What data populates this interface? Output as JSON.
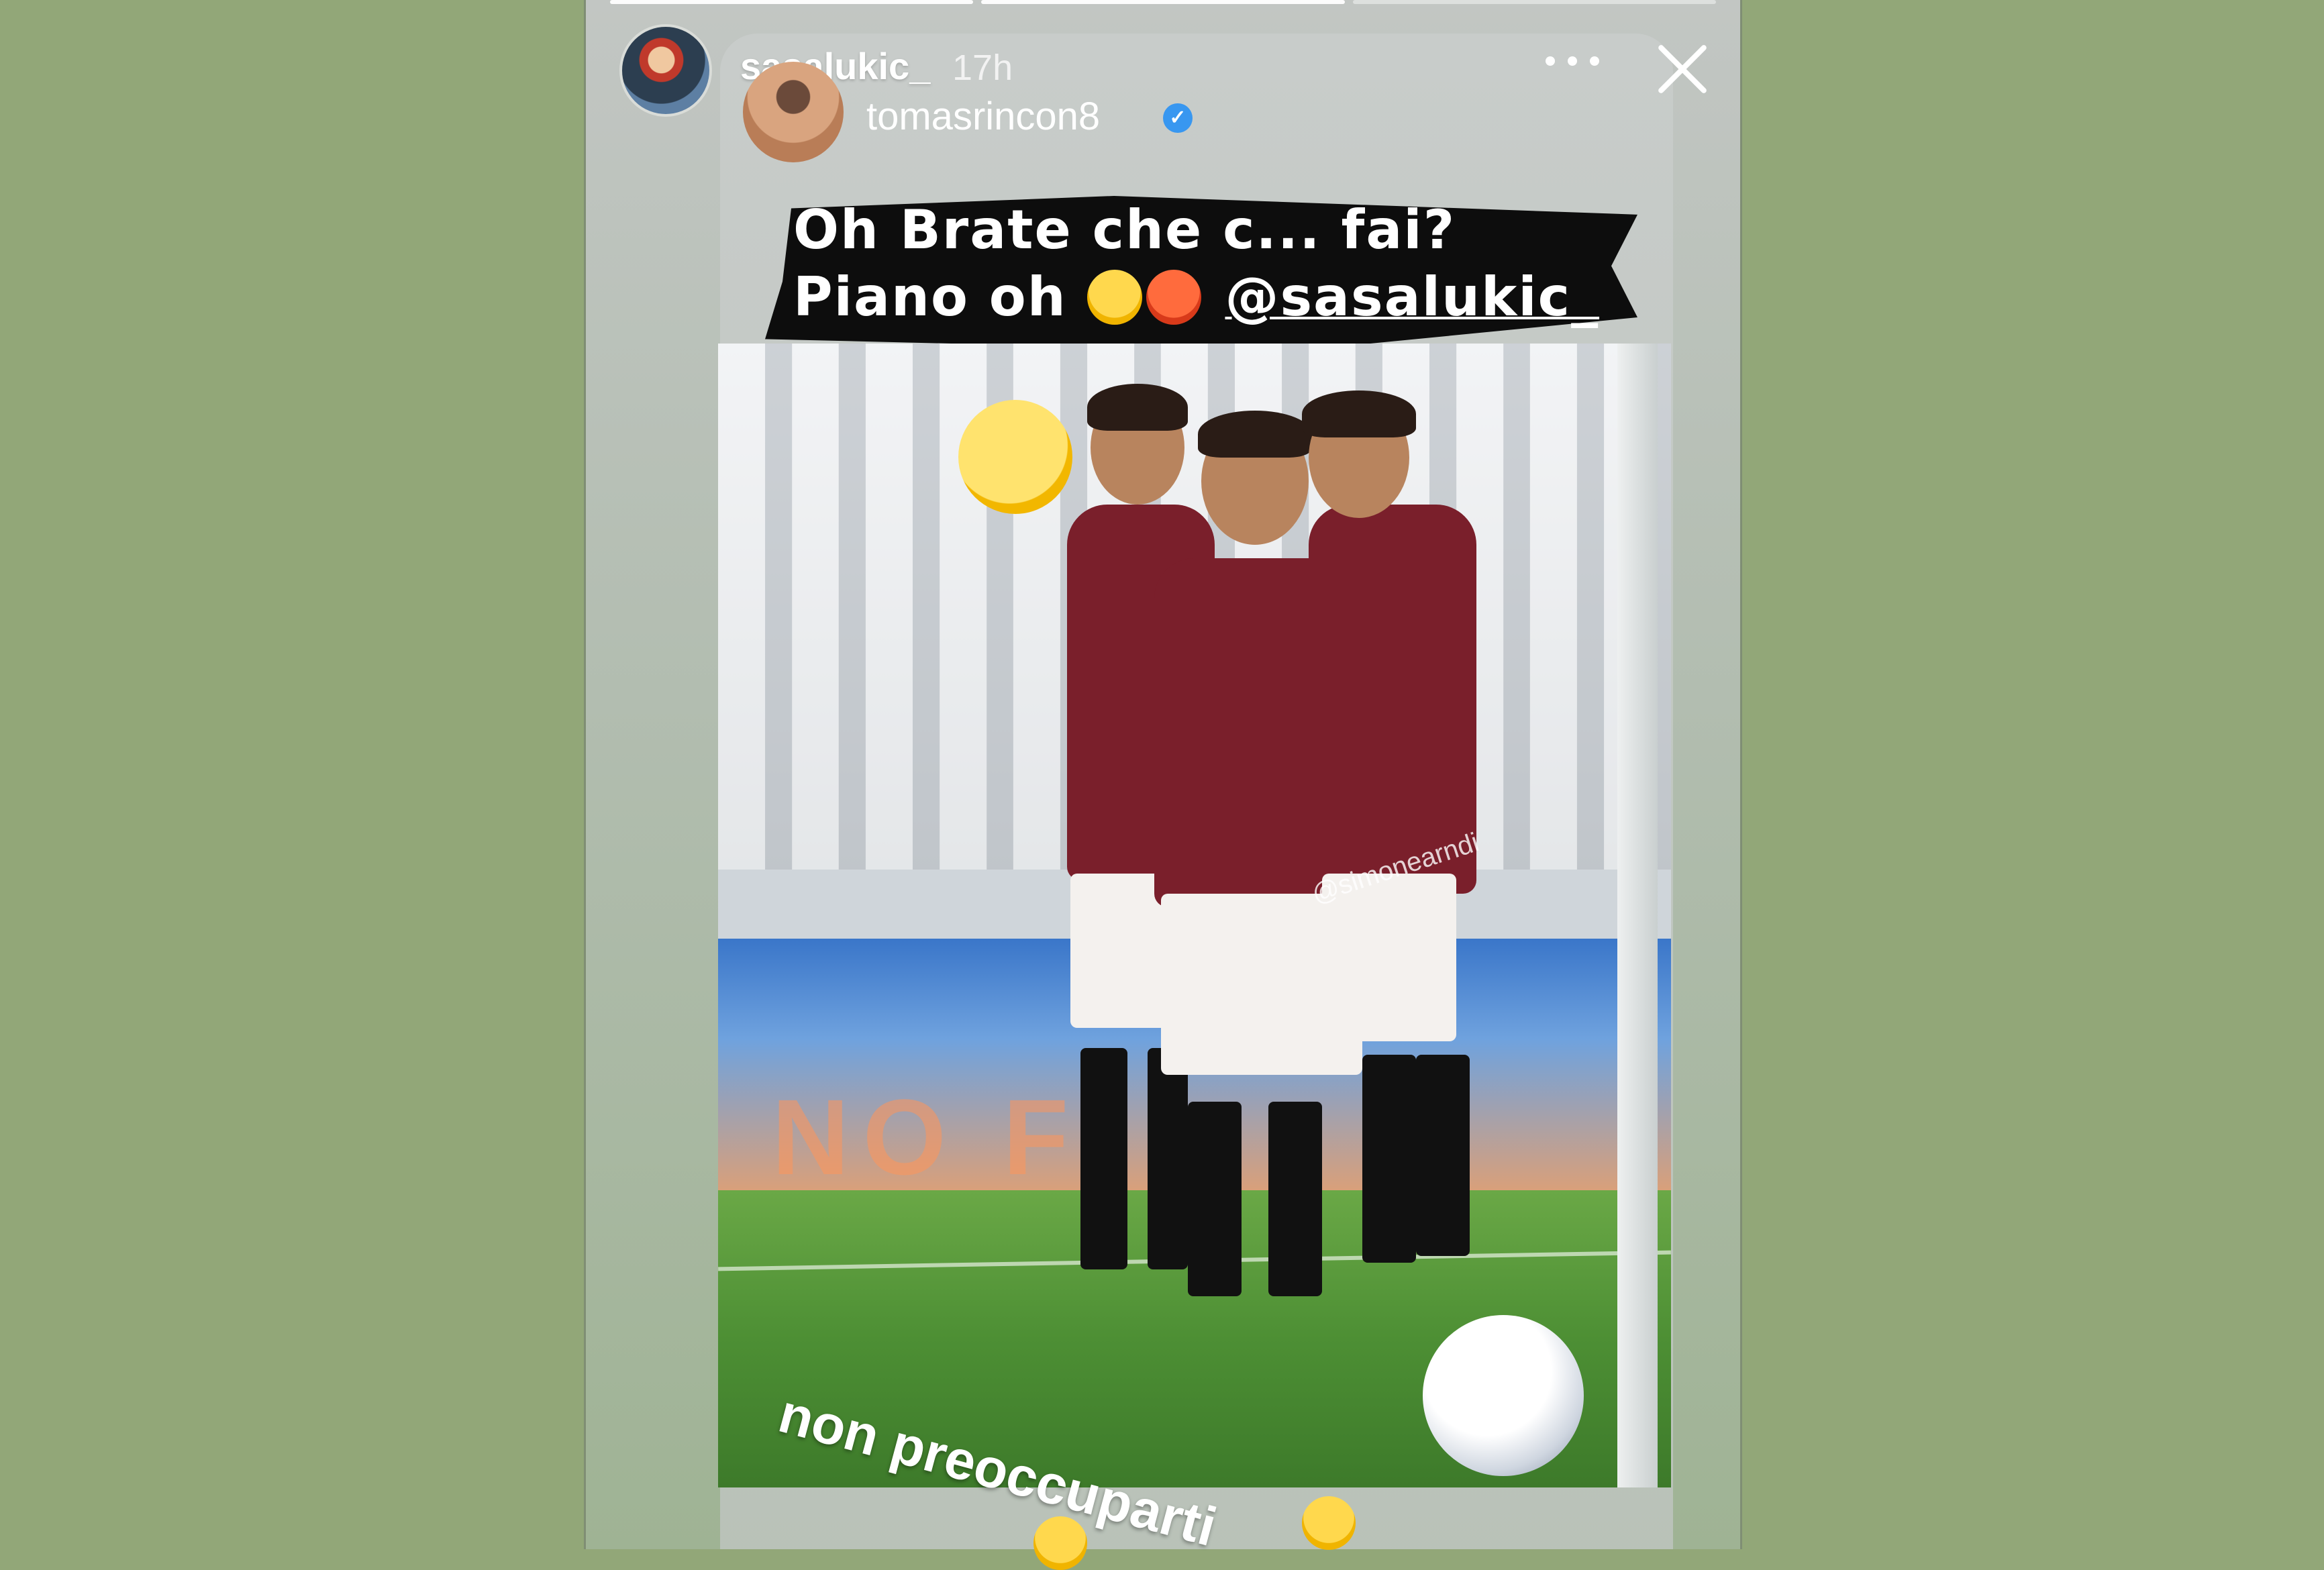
{
  "story": {
    "username": "sasalukic_",
    "time": "17h",
    "reposted_user": "tomasrincon8",
    "verified_mark": "✓"
  },
  "caption": {
    "line1": "Oh Brate che c... fai?",
    "line2_prefix": "Piano oh",
    "mention": "@sasalukic_"
  },
  "photo": {
    "ad_text": "NO F",
    "watermark": "@simonearndi"
  },
  "reply_caption": "non preoccuparti",
  "icons": [
    "more-icon",
    "close-icon",
    "verified-badge-icon",
    "thinking-emoji-icon",
    "sweat-smile-emoji-icon",
    "angry-emoji-icon"
  ],
  "colors": {
    "background": "#92a778",
    "jersey": "#7a1f2b",
    "verified": "#3897f0"
  }
}
